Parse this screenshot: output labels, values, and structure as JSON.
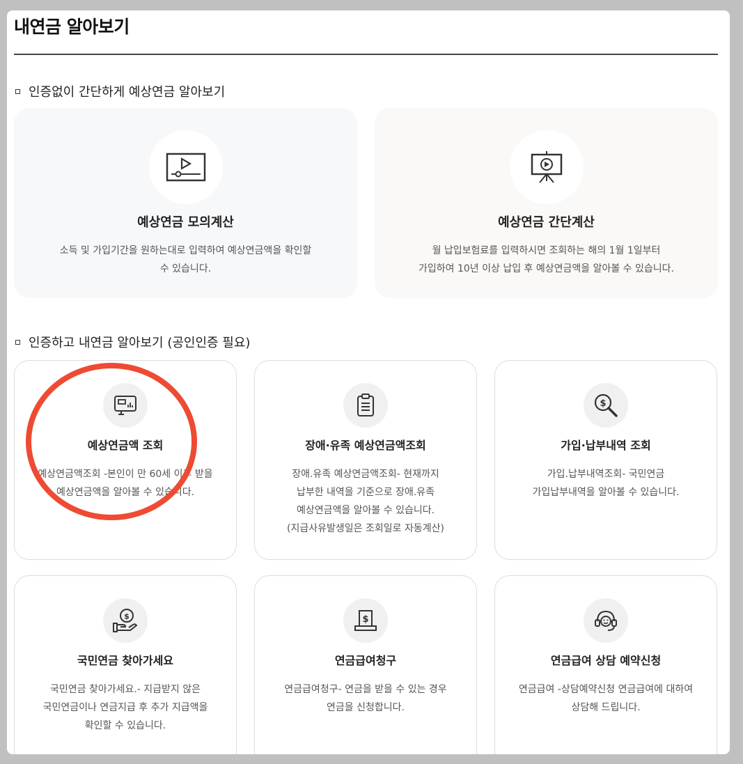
{
  "page": {
    "title": "내연금 알아보기"
  },
  "section1": {
    "heading": "인증없이 간단하게 예상연금 알아보기",
    "cards": [
      {
        "title": "예상연금 모의계산",
        "desc_lines": [
          "소득 및 가입기간을 원하는대로 입력하여 예상연금액을 확인할",
          "수 있습니다."
        ],
        "icon": "video-player-icon"
      },
      {
        "title": "예상연금 간단계산",
        "desc_lines": [
          "월 납입보험료를 입력하시면 조회하는 해의 1월 1일부터",
          "가입하여 10년 이상 납입 후 예상연금액을 알아볼 수 있습니다."
        ],
        "icon": "presentation-play-icon"
      }
    ]
  },
  "section2": {
    "heading": "인증하고 내연금 알아보기 (공인인증 필요)",
    "cards": [
      {
        "title": "예상연금액 조회",
        "desc_lines": [
          "예상연금액조회 -본인이 만 60세 이후 받을",
          "예상연금액을 알아볼 수 있습니다."
        ],
        "icon": "monitor-chart-icon"
      },
      {
        "title": "장애·유족 예상연금액조회",
        "desc_lines": [
          "장애.유족 예상연금액조회- 현재까지",
          "납부한 내역을 기준으로 장애.유족",
          "예상연금액을 알아볼 수 있습니다.",
          "(지급사유발생일은 조회일로 자동계산)"
        ],
        "icon": "clipboard-icon"
      },
      {
        "title": "가입·납부내역 조회",
        "desc_lines": [
          "가입.납부내역조회- 국민연금",
          "가입납부내역을 알아볼 수 있습니다."
        ],
        "icon": "magnifier-dollar-icon"
      },
      {
        "title": "국민연금 찾아가세요",
        "desc_lines": [
          "국민연금 찾아가세요.- 지급받지 않은",
          "국민연금이나 연금지급 후 추가 지급액을",
          "확인할 수 있습니다."
        ],
        "icon": "hand-coin-icon"
      },
      {
        "title": "연금급여청구",
        "desc_lines": [
          "연금급여청구- 연금을 받을 수 있는 경우",
          "연금을 신청합니다."
        ],
        "icon": "document-dollar-icon"
      },
      {
        "title": "연금급여 상담 예약신청",
        "desc_lines": [
          "연금급여 -상담예약신청 연금급여에 대하여",
          "상담해 드립니다."
        ],
        "icon": "headset-icon"
      }
    ]
  },
  "colors": {
    "background": "#c0c0c0",
    "panel": "#ffffff",
    "annotation": "#ee4b33",
    "card_border": "#dcdcdc"
  }
}
